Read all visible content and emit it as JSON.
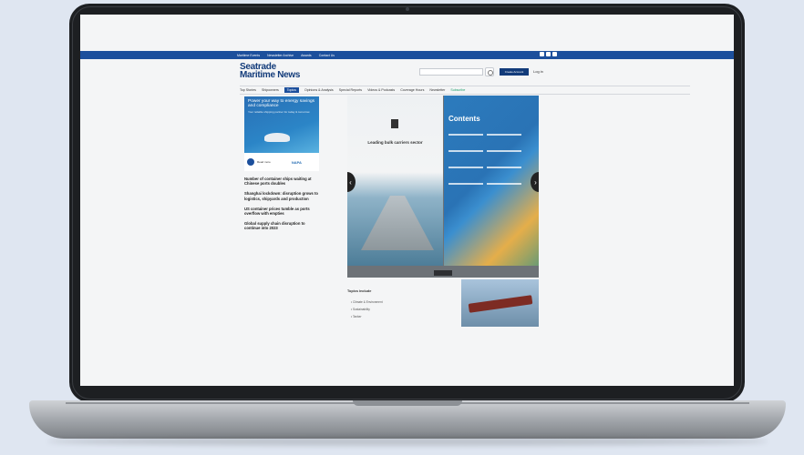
{
  "topbar": {
    "links": [
      "Maritime Events",
      "Newsletter Archive",
      "Awards",
      "Contact Us"
    ],
    "social_icons": [
      "facebook-icon",
      "linkedin-icon",
      "twitter-icon"
    ]
  },
  "header": {
    "logo_line1": "Seatrade",
    "logo_line2": "Maritime News",
    "search_placeholder": "",
    "create_account_label": "Create Account",
    "login_label": "Log in"
  },
  "nav": {
    "items": [
      {
        "label": "Top Stories",
        "active": false
      },
      {
        "label": "Shipowners",
        "active": false
      },
      {
        "label": "Topics",
        "active": true
      },
      {
        "label": "Opinions & Analysis",
        "active": false
      },
      {
        "label": "Special Reports",
        "active": false
      },
      {
        "label": "Videos & Podcasts",
        "active": false
      },
      {
        "label": "Coverage Hours",
        "active": false
      },
      {
        "label": "Newsletter",
        "active": false
      },
      {
        "label": "Subscribe",
        "active": false,
        "green": true
      }
    ]
  },
  "sidebar": {
    "ad_headline": "Power your way to energy savings and compliance",
    "ad_sub": "Your reliable shipping partner for today & tomorrow",
    "ad_read_more": "Read more",
    "ad_brand": "NAPA",
    "news": [
      {
        "title": "Number of container ships waiting at Chinese ports doubles",
        "date": ""
      },
      {
        "title": "Shanghai lockdown: disruption grows to logistics, shipyards and production",
        "date": ""
      },
      {
        "title": "US container prices tumble as ports overflow with empties",
        "date": ""
      },
      {
        "title": "Global supply chain disruption to continue into 2023",
        "date": ""
      }
    ]
  },
  "viewer": {
    "left_page_title": "Leading bulk carriers sector",
    "left_page_sub": "",
    "right_page_heading": "Contents",
    "prev_label": "‹",
    "next_label": "›"
  },
  "article": {
    "body": "",
    "topics_heading": "Topics include",
    "topics": [
      "Climate & Environment",
      "Sustainability",
      "Tanker"
    ]
  },
  "colors": {
    "brand_blue": "#1c4f9c",
    "dark_blue": "#123b7a",
    "green_accent": "#1d9e6b"
  }
}
